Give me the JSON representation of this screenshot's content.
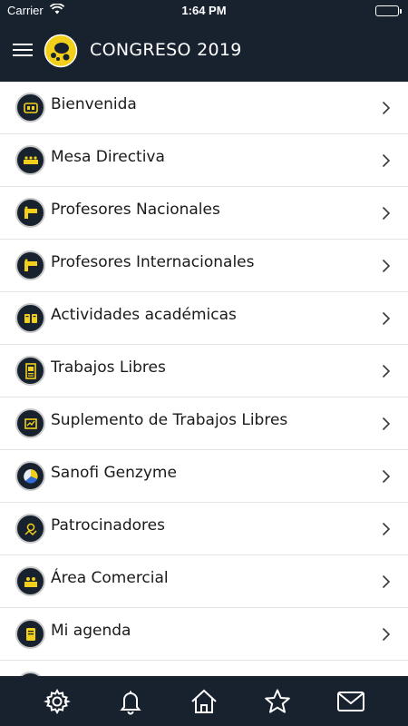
{
  "status_bar": {
    "carrier": "Carrier",
    "time": "1:64 PM",
    "wifi_icon": "wifi-icon",
    "battery_icon": "battery-icon"
  },
  "header": {
    "title": "CONGRESO 2019",
    "menu_icon": "hamburger-menu-icon",
    "logo_icon": "congress-logo-icon"
  },
  "colors": {
    "nav_background": "#18222f",
    "accent_yellow": "#f2cf1a",
    "text": "#1a1a1a",
    "divider": "#e3e3e3"
  },
  "menu": {
    "items": [
      {
        "label": "Bienvenida",
        "icon": "welcome-icon"
      },
      {
        "label": "Mesa Directiva",
        "icon": "board-table-icon"
      },
      {
        "label": "Profesores Nacionales",
        "icon": "national-professor-icon"
      },
      {
        "label": "Profesores Internacionales",
        "icon": "international-professor-icon"
      },
      {
        "label": "Actividades académicas",
        "icon": "academic-activities-icon"
      },
      {
        "label": "Trabajos Libres",
        "icon": "free-papers-icon"
      },
      {
        "label": "Suplemento de Trabajos Libres",
        "icon": "supplement-icon"
      },
      {
        "label": "Sanofi Genzyme",
        "icon": "sanofi-genzyme-icon"
      },
      {
        "label": "Patrocinadores",
        "icon": "sponsors-icon"
      },
      {
        "label": "Área Comercial",
        "icon": "commercial-area-icon"
      },
      {
        "label": "Mi agenda",
        "icon": "agenda-icon"
      }
    ]
  },
  "tab_bar": {
    "tabs": [
      {
        "icon": "settings-gear-icon"
      },
      {
        "icon": "notifications-bell-icon"
      },
      {
        "icon": "home-icon"
      },
      {
        "icon": "favorites-star-icon"
      },
      {
        "icon": "messages-mail-icon"
      }
    ]
  }
}
